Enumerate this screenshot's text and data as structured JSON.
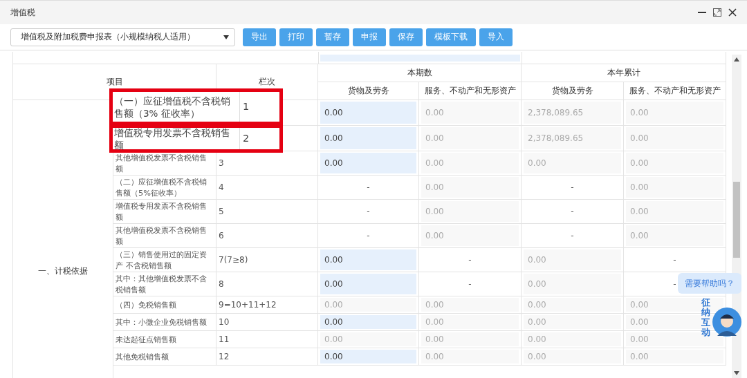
{
  "window": {
    "title": "增值税"
  },
  "form_select": {
    "value": "增值税及附加税费申报表（小规模纳税人适用）"
  },
  "toolbar_buttons": [
    "导出",
    "打印",
    "暂存",
    "申报",
    "保存",
    "模板下载",
    "导入"
  ],
  "table": {
    "header": {
      "item": "项目",
      "line": "栏次",
      "groups": [
        {
          "label": "本期数",
          "columns": [
            "货物及劳务",
            "服务、不动产和无形资产"
          ]
        },
        {
          "label": "本年累计",
          "columns": [
            "货物及劳务",
            "服务、不动产和无形资产"
          ]
        }
      ]
    },
    "section": "一、计税依据",
    "rows": [
      {
        "item": "（一）应征增值税不含税销售额（3% 征收率）",
        "line": "1",
        "highlighted": true,
        "values": [
          {
            "kind": "input",
            "text": "0.00"
          },
          {
            "kind": "readonly",
            "text": "0.00"
          },
          {
            "kind": "readonly",
            "text": "2,378,089.65"
          },
          {
            "kind": "readonly",
            "text": "0.00"
          }
        ]
      },
      {
        "item": "增值税专用发票不含税销售额",
        "line": "2",
        "highlighted": true,
        "values": [
          {
            "kind": "input",
            "text": "0.00"
          },
          {
            "kind": "readonly",
            "text": "0.00"
          },
          {
            "kind": "readonly",
            "text": "2,378,089.65"
          },
          {
            "kind": "readonly",
            "text": "0.00"
          }
        ]
      },
      {
        "item": "其他增值税发票不含税销售额",
        "line": "3",
        "highlighted": false,
        "values": [
          {
            "kind": "input",
            "text": "0.00"
          },
          {
            "kind": "readonly",
            "text": "0.00"
          },
          {
            "kind": "readonly",
            "text": "0.00"
          },
          {
            "kind": "readonly",
            "text": "0.00"
          }
        ]
      },
      {
        "item": "（二）应征增值税不含税销售额（5%征收率）",
        "line": "4",
        "highlighted": false,
        "values": [
          {
            "kind": "dash",
            "text": "-"
          },
          {
            "kind": "readonly",
            "text": "0.00"
          },
          {
            "kind": "dash",
            "text": "-"
          },
          {
            "kind": "readonly",
            "text": "0.00"
          }
        ]
      },
      {
        "item": "增值税专用发票不含税销售额",
        "line": "5",
        "highlighted": false,
        "values": [
          {
            "kind": "dash",
            "text": "-"
          },
          {
            "kind": "readonly",
            "text": "0.00"
          },
          {
            "kind": "dash",
            "text": "-"
          },
          {
            "kind": "readonly",
            "text": "0.00"
          }
        ]
      },
      {
        "item": "其他增值税发票不含税销售额",
        "line": "6",
        "highlighted": false,
        "values": [
          {
            "kind": "dash",
            "text": "-"
          },
          {
            "kind": "readonly",
            "text": "0.00"
          },
          {
            "kind": "dash",
            "text": "-"
          },
          {
            "kind": "readonly",
            "text": "0.00"
          }
        ]
      },
      {
        "item": "（三）销售使用过的固定资产 不含税销售额",
        "line": "7(7≥8)",
        "highlighted": false,
        "values": [
          {
            "kind": "input",
            "text": "0.00"
          },
          {
            "kind": "dash",
            "text": "-"
          },
          {
            "kind": "readonly",
            "text": "0.00"
          },
          {
            "kind": "dash",
            "text": "-"
          }
        ]
      },
      {
        "item": "其中：其他增值税发票不含税销售额",
        "line": "8",
        "highlighted": false,
        "values": [
          {
            "kind": "input",
            "text": "0.00"
          },
          {
            "kind": "dash",
            "text": "-"
          },
          {
            "kind": "readonly",
            "text": "0.00"
          },
          {
            "kind": "dash",
            "text": "-"
          }
        ]
      },
      {
        "item": "（四）免税销售额",
        "line": "9=10+11+12",
        "highlighted": false,
        "values": [
          {
            "kind": "readonly",
            "text": "0.00"
          },
          {
            "kind": "readonly",
            "text": "0.00"
          },
          {
            "kind": "readonly",
            "text": "0.00"
          },
          {
            "kind": "readonly",
            "text": "0.00"
          }
        ]
      },
      {
        "item": "其中：小微企业免税销售额",
        "line": "10",
        "highlighted": false,
        "values": [
          {
            "kind": "input",
            "text": "0.00"
          },
          {
            "kind": "readonly",
            "text": "0.00"
          },
          {
            "kind": "readonly",
            "text": "0.00"
          },
          {
            "kind": "readonly",
            "text": "0.00"
          }
        ]
      },
      {
        "item": "未达起征点销售额",
        "line": "11",
        "highlighted": false,
        "values": [
          {
            "kind": "readonly",
            "text": "0.00"
          },
          {
            "kind": "readonly",
            "text": "0.00"
          },
          {
            "kind": "readonly",
            "text": "0.00"
          },
          {
            "kind": "readonly",
            "text": "0.00"
          }
        ]
      },
      {
        "item": "其他免税销售额",
        "line": "12",
        "highlighted": false,
        "values": [
          {
            "kind": "input",
            "text": "0.00"
          },
          {
            "kind": "readonly",
            "text": "0.00"
          },
          {
            "kind": "readonly",
            "text": "0.00"
          },
          {
            "kind": "readonly",
            "text": "0.00"
          }
        ]
      }
    ]
  },
  "help": {
    "bubble": "需要帮助吗？",
    "badge": "征纳互动"
  }
}
